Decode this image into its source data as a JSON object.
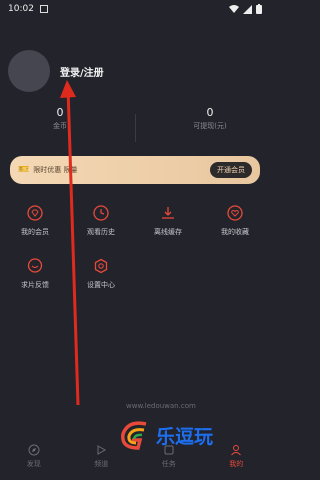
{
  "status_bar": {
    "time": "10:02"
  },
  "profile": {
    "login_text": "登录/注册"
  },
  "stats": [
    {
      "value": "0",
      "label": "金币"
    },
    {
      "value": "0",
      "label": "可提现(元)"
    }
  ],
  "vip_banner": {
    "promo_text": "限时优惠 限量",
    "button_label": "开通会员"
  },
  "menu_items": [
    {
      "label": "我的会员",
      "icon": "gem-icon"
    },
    {
      "label": "观看历史",
      "icon": "clock-icon"
    },
    {
      "label": "离线缓存",
      "icon": "download-icon"
    },
    {
      "label": "我的收藏",
      "icon": "heart-icon"
    },
    {
      "label": "求片反馈",
      "icon": "chat-icon"
    },
    {
      "label": "设置中心",
      "icon": "settings-icon"
    }
  ],
  "tabs": [
    {
      "label": "发现",
      "icon": "compass-icon"
    },
    {
      "label": "频道",
      "icon": "play-icon"
    },
    {
      "label": "任务",
      "icon": "task-icon"
    },
    {
      "label": "我的",
      "icon": "user-icon",
      "active": true
    }
  ],
  "watermark": {
    "brand": "乐逗玩",
    "url": "www.ledouwan.com"
  },
  "colors": {
    "accent": "#e84a3a",
    "background": "#22232b",
    "banner": "#f4d8b5"
  }
}
